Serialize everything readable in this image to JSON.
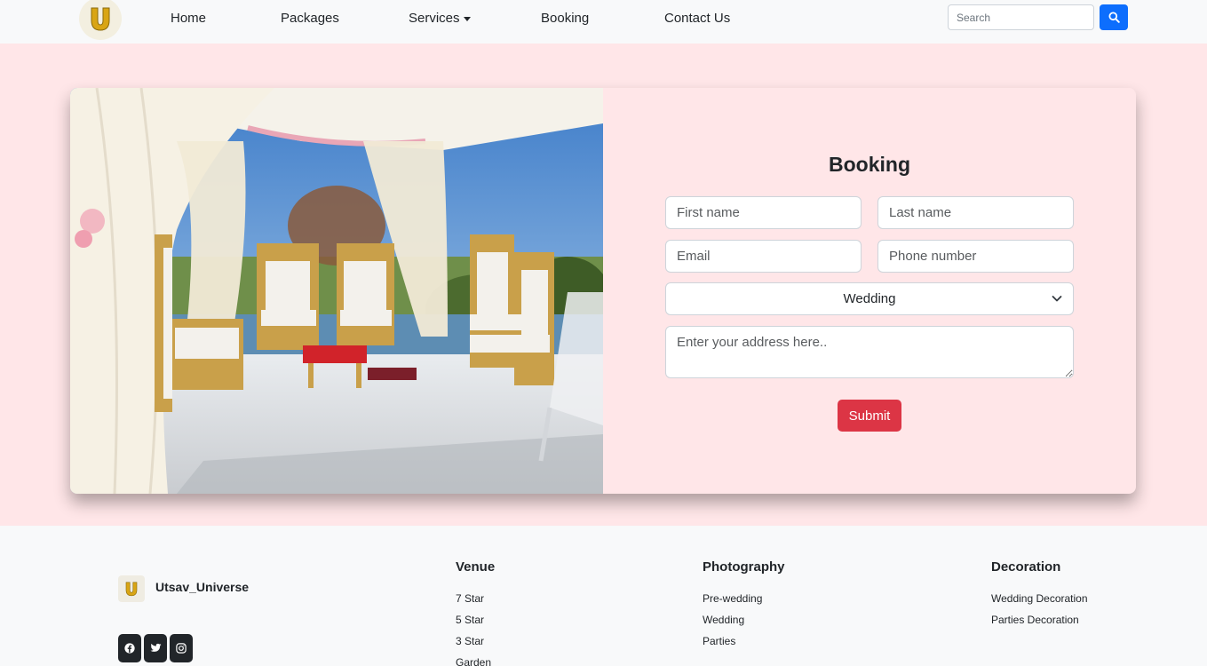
{
  "nav": {
    "items": [
      {
        "label": "Home"
      },
      {
        "label": "Packages"
      },
      {
        "label": "Services"
      },
      {
        "label": "Booking"
      },
      {
        "label": "Contact Us"
      }
    ],
    "search_placeholder": "Search"
  },
  "booking": {
    "title": "Booking",
    "first_name_placeholder": "First name",
    "last_name_placeholder": "Last name",
    "email_placeholder": "Email",
    "phone_placeholder": "Phone number",
    "event_type_selected": "Wedding",
    "address_placeholder": "Enter your address here..",
    "submit_label": "Submit"
  },
  "footer": {
    "brand": "Utsav_Universe",
    "columns": [
      {
        "heading": "Venue",
        "links": [
          "7 Star",
          "5 Star",
          "3 Star",
          "Garden"
        ]
      },
      {
        "heading": "Photography",
        "links": [
          "Pre-wedding",
          "Wedding",
          "Parties"
        ]
      },
      {
        "heading": "Decoration",
        "links": [
          "Wedding Decoration",
          "Parties Decoration"
        ]
      }
    ],
    "social_icons": [
      "facebook-icon",
      "twitter-icon",
      "instagram-icon"
    ]
  },
  "colors": {
    "hero_bg": "#ffe6e8",
    "primary": "#0d6efd",
    "danger": "#dc3545",
    "logo_gold": "#d4a017"
  }
}
